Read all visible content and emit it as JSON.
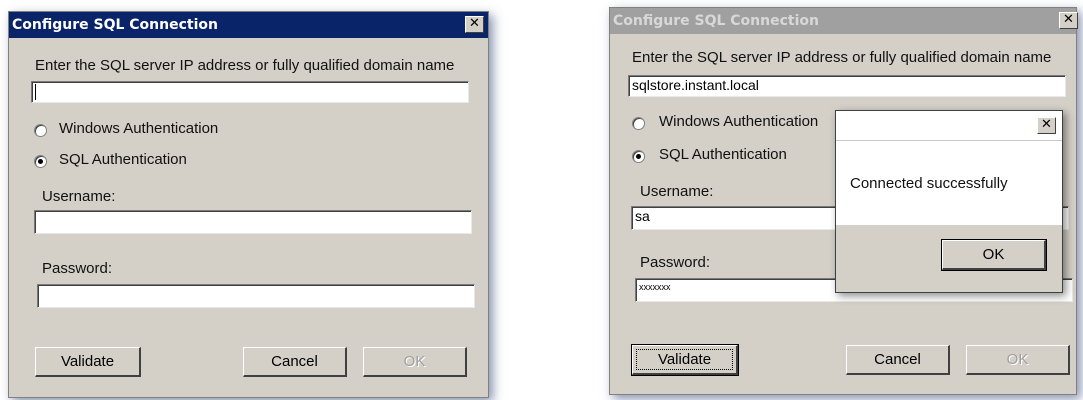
{
  "left_dialog": {
    "title": "Configure SQL Connection",
    "close_glyph": "✕",
    "prompt": "Enter the SQL server IP address or fully qualified domain name",
    "server_value": "",
    "windows_auth_label": "Windows Authentication",
    "sql_auth_label": "SQL Authentication",
    "selected_auth": "SQL Authentication",
    "username_label": "Username:",
    "username_value": "",
    "password_label": "Password:",
    "password_value": "",
    "validate_label": "Validate",
    "cancel_label": "Cancel",
    "ok_label": "OK"
  },
  "right_dialog": {
    "title": "Configure SQL Connection",
    "close_glyph": "✕",
    "prompt": "Enter the SQL server IP address or fully qualified domain name",
    "server_value": "sqlstore.instant.local",
    "windows_auth_label": "Windows Authentication",
    "sql_auth_label": "SQL Authentication",
    "selected_auth": "SQL Authentication",
    "username_label": "Username:",
    "username_value": "sa",
    "password_label": "Password:",
    "password_value": "xxxxxxx",
    "validate_label": "Validate",
    "cancel_label": "Cancel",
    "ok_label": "OK"
  },
  "message_box": {
    "title": "",
    "close_glyph": "✕",
    "message": "Connected successfully",
    "ok_label": "OK"
  },
  "colors": {
    "dialog_face": "#d4d0c8",
    "active_titlebar": "#0a246a",
    "inactive_titlebar": "#a0a0a0"
  }
}
